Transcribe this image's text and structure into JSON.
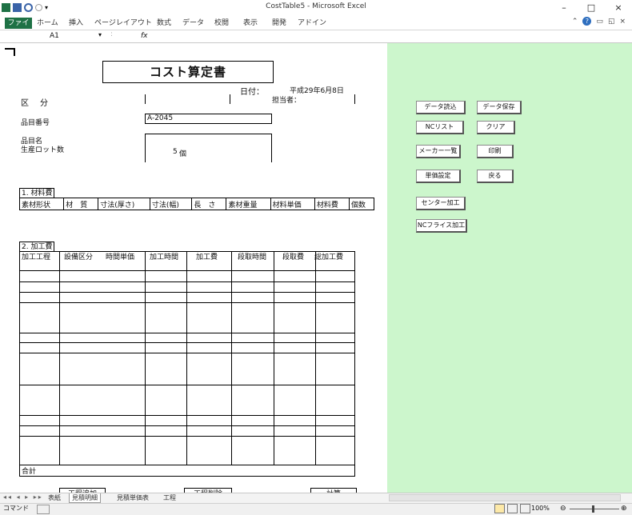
{
  "window": {
    "title": "CostTable5 - Microsoft Excel",
    "controls": {
      "minimize": "–",
      "maximize": "□",
      "close": "×"
    }
  },
  "ribbon": {
    "file_tab": "ファイル",
    "tabs": [
      "ホーム",
      "挿入",
      "ページレイアウト",
      "数式",
      "データ",
      "校閲",
      "表示",
      "開発",
      "アドイン"
    ],
    "right_icons": [
      "chevron-up-icon",
      "help-icon",
      "minimize-icon",
      "restore-icon",
      "close-icon"
    ]
  },
  "formula_bar": {
    "name_box": "A1",
    "fx_label": "fx",
    "formula": ""
  },
  "sheet": {
    "doc_title": "コスト算定書",
    "date_label": "日付：",
    "date_value": "平成29年6月8日",
    "owner_label": "担当者：",
    "owner_value": "",
    "kubun_label": "区　分",
    "hinban_label": "品目番号",
    "hinban_value": "A-2045",
    "hinmei_label": "品目名",
    "lot_label": "生産ロット数",
    "lot_value": "5",
    "lot_unit": "個",
    "material_section": "1. 材料費",
    "material_headers": [
      "素材形状",
      "材　質",
      "寸法(厚さ)",
      "寸法(幅)",
      "長　さ",
      "素材重量",
      "材料単価",
      "材料費",
      "個数"
    ],
    "process_section": "2. 加工費",
    "process_headers": [
      "加工工程",
      "設備区分",
      "時間単価",
      "加工時間",
      "加工費",
      "段取時間",
      "段取費",
      "総加工費"
    ],
    "total_label": "合計",
    "bottom_buttons": [
      "工程追加",
      "工程削除",
      "計算"
    ]
  },
  "side_buttons": [
    {
      "label": "データ読込"
    },
    {
      "label": "データ保存"
    },
    {
      "label": "NCリスト"
    },
    {
      "label": "クリア"
    },
    {
      "label": "メーカー一覧"
    },
    {
      "label": "印刷"
    },
    {
      "label": "単価設定"
    },
    {
      "label": "戻る"
    },
    {
      "label": "センター加工"
    },
    {
      "label": "NCフライス加工"
    }
  ],
  "sheet_tabs": [
    "表紙",
    "見積明細",
    "見積単価表",
    "工程"
  ],
  "status": {
    "mode": "コマンド",
    "zoom": "100%"
  }
}
